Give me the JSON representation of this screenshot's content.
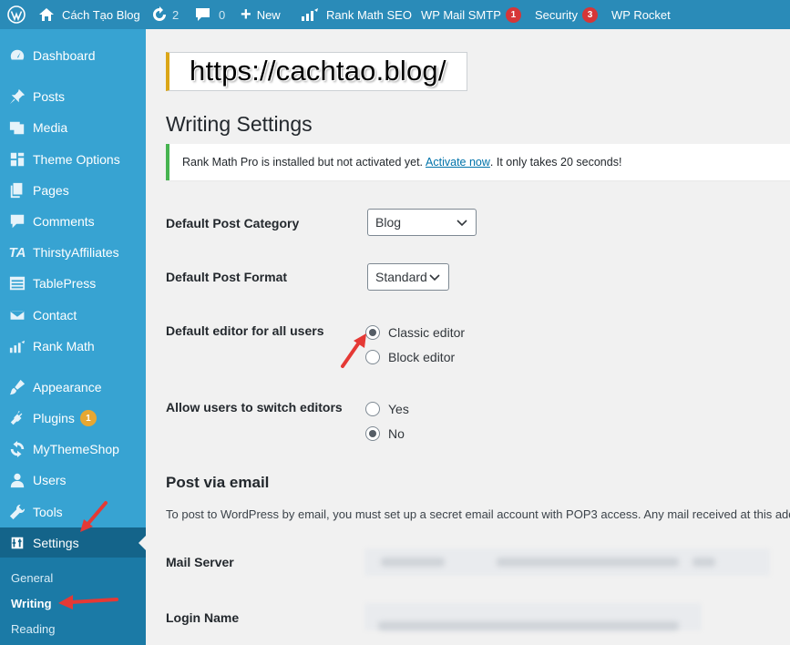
{
  "adminbar": {
    "site_name": "Cách Tạo Blog",
    "updates_count": "2",
    "comments_count": "0",
    "new_label": "New",
    "rankmath_label": "Rank Math SEO",
    "mailsmtp_label": "WP Mail SMTP",
    "mailsmtp_badge": "1",
    "security_label": "Security",
    "security_badge": "3",
    "rocket_label": "WP Rocket"
  },
  "sidebar": {
    "items": [
      {
        "label": "Dashboard",
        "icon": "dashboard-icon"
      },
      {
        "label": "Posts",
        "icon": "pin-icon"
      },
      {
        "label": "Media",
        "icon": "media-icon"
      },
      {
        "label": "Theme Options",
        "icon": "grid-icon"
      },
      {
        "label": "Pages",
        "icon": "pages-icon"
      },
      {
        "label": "Comments",
        "icon": "comment-icon"
      },
      {
        "label": "ThirstyAffiliates",
        "icon": "ta-logo-icon"
      },
      {
        "label": "TablePress",
        "icon": "table-icon"
      },
      {
        "label": "Contact",
        "icon": "envelope-icon"
      },
      {
        "label": "Rank Math",
        "icon": "chart-icon"
      },
      {
        "label": "Appearance",
        "icon": "brush-icon"
      },
      {
        "label": "Plugins",
        "icon": "plug-icon",
        "badge": "1"
      },
      {
        "label": "MyThemeShop",
        "icon": "refresh-icon"
      },
      {
        "label": "Users",
        "icon": "user-icon"
      },
      {
        "label": "Tools",
        "icon": "wrench-icon"
      },
      {
        "label": "Settings",
        "icon": "sliders-icon"
      }
    ],
    "submenu": [
      "General",
      "Writing",
      "Reading"
    ]
  },
  "content": {
    "watermark": "https://cachtao.blog/",
    "title": "Writing Settings",
    "notice_before": "Rank Math Pro is installed but not activated yet.",
    "notice_link": "Activate now",
    "notice_after": ". It only takes 20 seconds!",
    "default_category_label": "Default Post Category",
    "default_category_value": "Blog",
    "default_format_label": "Default Post Format",
    "default_format_value": "Standard",
    "default_editor_label": "Default editor for all users",
    "editor_options": [
      "Classic editor",
      "Block editor"
    ],
    "editor_selected": "Classic editor",
    "switch_label": "Allow users to switch editors",
    "switch_options": [
      "Yes",
      "No"
    ],
    "switch_selected": "No",
    "post_email_title": "Post via email",
    "post_email_desc": "To post to WordPress by email, you must set up a secret email account with POP3 access. Any mail received at this addre",
    "mail_server_label": "Mail Server",
    "login_name_label": "Login Name"
  },
  "colors": {
    "adminbar_bg": "#2a8bb8",
    "sidebar_bg": "#37a3d2",
    "sidebar_current": "#14648a",
    "submenu_bg": "#1b7aa6",
    "badge_red": "#d63638",
    "badge_orange": "#e7a732",
    "notice_border": "#46b450",
    "arrow_red": "#e53935"
  }
}
